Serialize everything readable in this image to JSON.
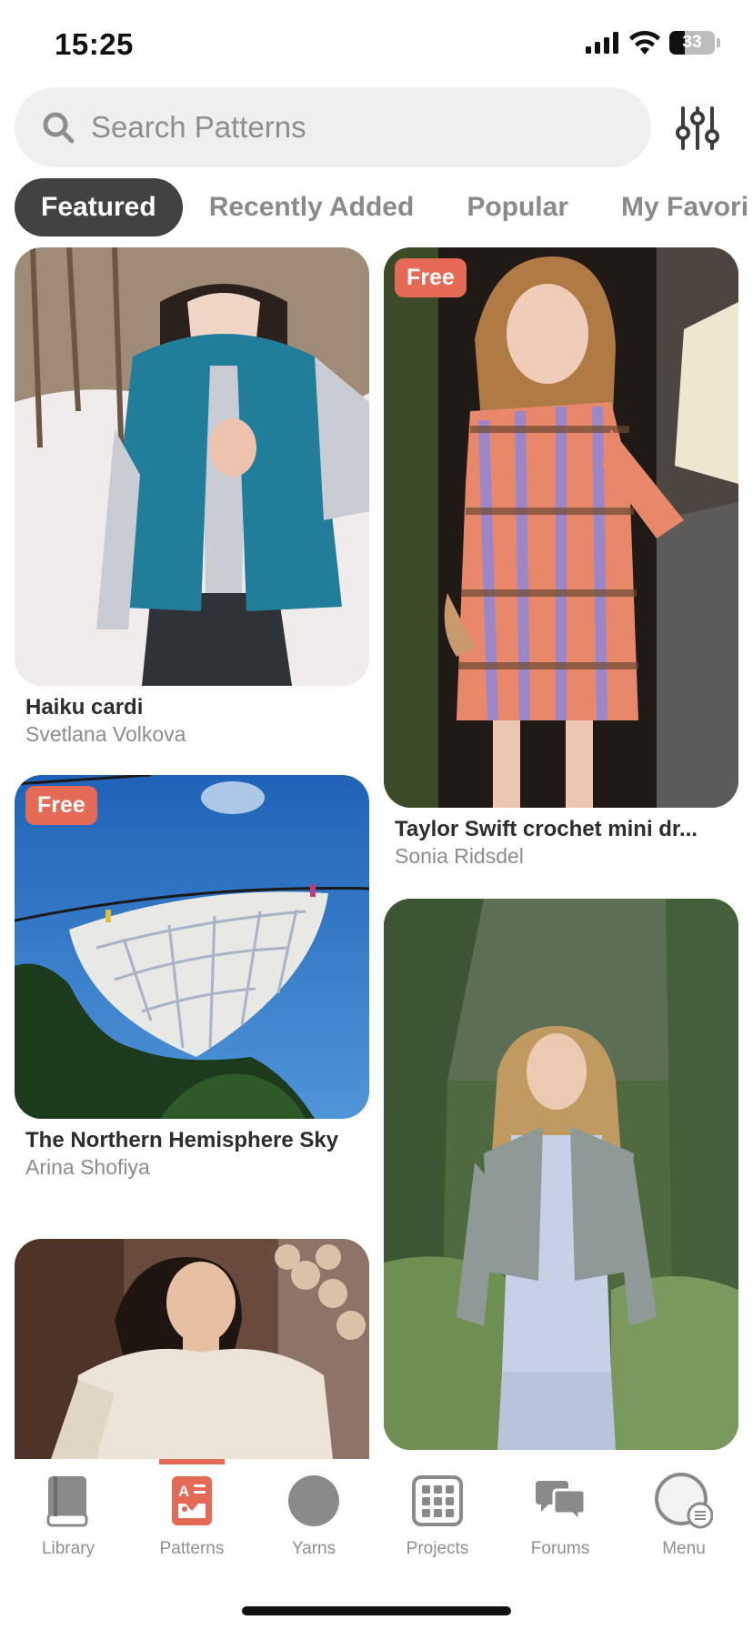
{
  "status_bar": {
    "time": "15:25",
    "battery": "33",
    "battery_level": 0.33
  },
  "search": {
    "placeholder": "Search Patterns",
    "value": ""
  },
  "tabs": [
    {
      "label": "Featured",
      "active": true
    },
    {
      "label": "Recently Added",
      "active": false
    },
    {
      "label": "Popular",
      "active": false
    },
    {
      "label": "My Favori",
      "active": false
    }
  ],
  "cards": [
    {
      "title": "Haiku cardi",
      "author": "Svetlana Volkova",
      "free": false
    },
    {
      "title": "Taylor Swift crochet mini dr...",
      "author": "Sonia Ridsdel",
      "free": true,
      "badge": "Free"
    },
    {
      "title": "The Northern Hemisphere Sky",
      "author": "Arina Shofiya",
      "free": true,
      "badge": "Free"
    },
    {
      "title": "",
      "author": "",
      "free": false
    },
    {
      "title": "",
      "author": "",
      "free": false
    }
  ],
  "tab_bar": [
    {
      "label": "Library",
      "icon": "book-icon",
      "active": false
    },
    {
      "label": "Patterns",
      "icon": "pattern-icon",
      "active": true
    },
    {
      "label": "Yarns",
      "icon": "yarn-ball-icon",
      "active": false
    },
    {
      "label": "Projects",
      "icon": "projects-grid-icon",
      "active": false
    },
    {
      "label": "Forums",
      "icon": "chat-bubbles-icon",
      "active": false
    },
    {
      "label": "Menu",
      "icon": "menu-avatar-icon",
      "active": false
    }
  ],
  "colors": {
    "accent": "#e46a55",
    "active_tab_bg": "#424242",
    "search_bg": "#efefef"
  }
}
